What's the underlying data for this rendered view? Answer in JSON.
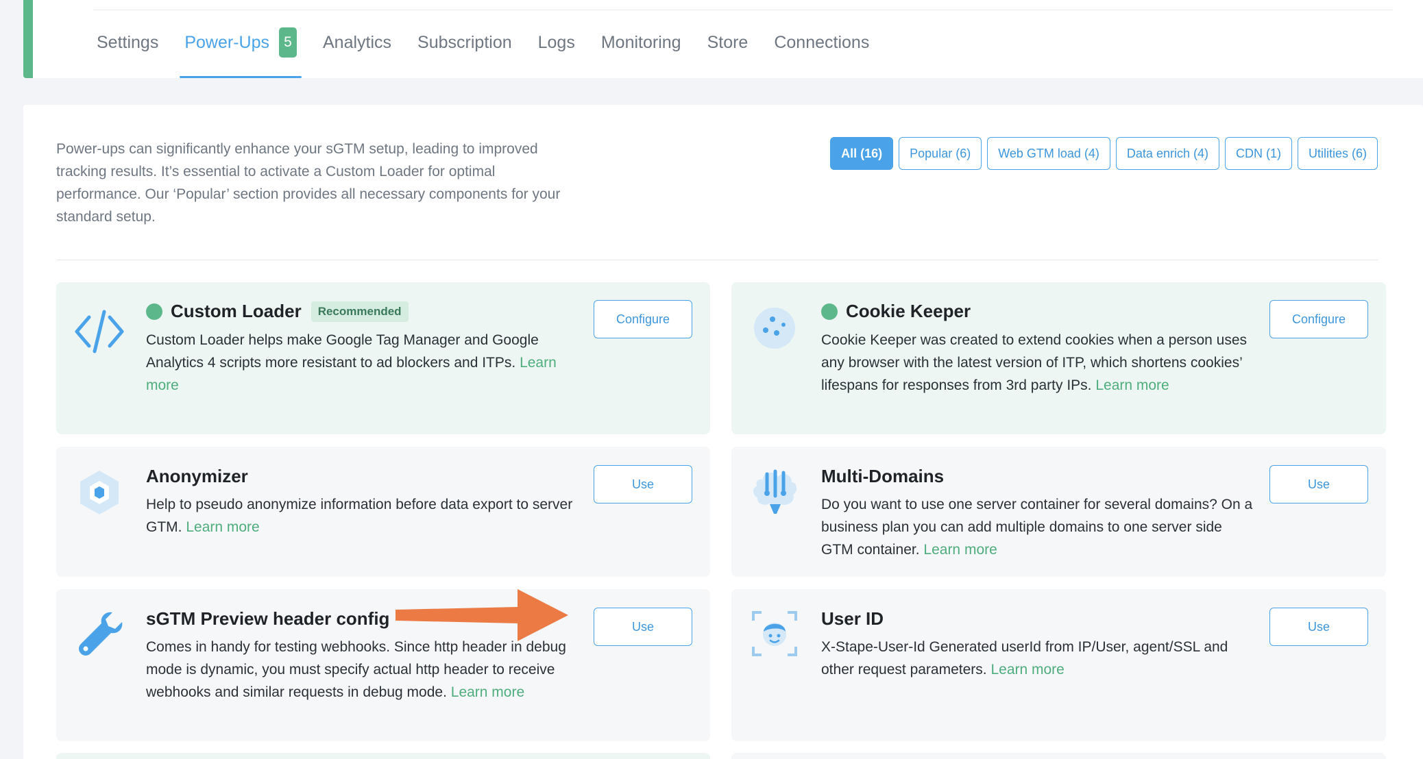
{
  "tabs": [
    {
      "label": "Settings"
    },
    {
      "label": "Power-Ups",
      "badge": "5"
    },
    {
      "label": "Analytics"
    },
    {
      "label": "Subscription"
    },
    {
      "label": "Logs"
    },
    {
      "label": "Monitoring"
    },
    {
      "label": "Store"
    },
    {
      "label": "Connections"
    }
  ],
  "intro": "Power-ups can significantly enhance your sGTM setup, leading to improved tracking results. It’s essential to activate a Custom Loader for optimal performance. Our ‘Popular’ section provides all necessary components for your standard setup.",
  "filters": [
    {
      "label": "All (16)"
    },
    {
      "label": "Popular (6)"
    },
    {
      "label": "Web GTM load (4)"
    },
    {
      "label": "Data enrich (4)"
    },
    {
      "label": "CDN (1)"
    },
    {
      "label": "Utilities (6)"
    }
  ],
  "cards": [
    {
      "title": "Custom Loader",
      "badge": "Recommended",
      "description": "Custom Loader helps make Google Tag Manager and Google Analytics 4 scripts more resistant to ad blockers and ITPs.",
      "learn_more": "Learn more",
      "button": "Configure",
      "icon": "code-icon"
    },
    {
      "title": "Cookie Keeper",
      "description": "Cookie Keeper was created to extend cookies when a person uses any browser with the latest version of ITP, which shortens cookies’ lifespans for responses from 3rd party IPs.",
      "learn_more": "Learn more",
      "button": "Configure",
      "icon": "cookie-icon"
    },
    {
      "title": "Anonymizer",
      "description": "Help to pseudo anonymize information before data export to server GTM.",
      "learn_more": "Learn more",
      "button": "Use",
      "icon": "hexagon-icon"
    },
    {
      "title": "Multi-Domains",
      "description": "Do you want to use one server container for several domains? On a business plan you can add multiple domains to one server side GTM container.",
      "learn_more": "Learn more",
      "button": "Use",
      "icon": "brain-icon"
    },
    {
      "title": "sGTM Preview header config",
      "description": "Comes in handy for testing webhooks. Since http header in debug mode is dynamic, you must specify actual http header to receive webhooks and similar requests in debug mode.",
      "learn_more": "Learn more",
      "button": "Use",
      "icon": "wrench-icon"
    },
    {
      "title": "User ID",
      "description": "X-Stape-User-Id Generated userId from IP/User, agent/SSL and other request parameters.",
      "learn_more": "Learn more",
      "button": "Use",
      "icon": "face-scan-icon"
    }
  ],
  "colors": {
    "accent_blue": "#4aa3e8",
    "accent_green": "#5cb88a",
    "arrow_orange": "#ec7a45",
    "active_card_bg": "#edf6f2"
  }
}
